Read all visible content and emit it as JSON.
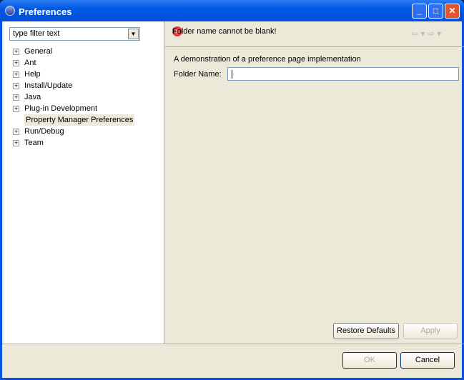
{
  "window": {
    "title": "Preferences"
  },
  "filter": {
    "placeholder": "type filter text"
  },
  "tree": [
    {
      "label": "General",
      "expandable": true
    },
    {
      "label": "Ant",
      "expandable": true
    },
    {
      "label": "Help",
      "expandable": true
    },
    {
      "label": "Install/Update",
      "expandable": true
    },
    {
      "label": "Java",
      "expandable": true
    },
    {
      "label": "Plug-in Development",
      "expandable": true
    },
    {
      "label": "Property Manager Preferences",
      "expandable": false,
      "selected": true
    },
    {
      "label": "Run/Debug",
      "expandable": true
    },
    {
      "label": "Team",
      "expandable": true
    }
  ],
  "page": {
    "error": "Folder name cannot be blank!",
    "description": "A demonstration of a preference page implementation",
    "folder_label": "Folder Name:",
    "folder_value": ""
  },
  "buttons": {
    "restore": "Restore Defaults",
    "apply": "Apply",
    "ok": "OK",
    "cancel": "Cancel"
  }
}
